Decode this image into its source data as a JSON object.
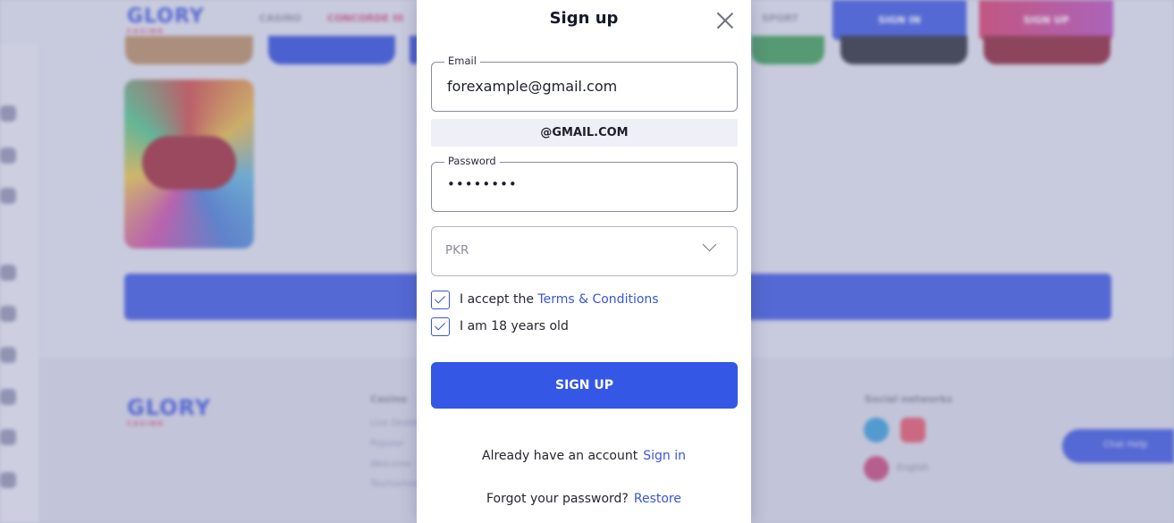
{
  "background": {
    "logo": {
      "word": "GLORY",
      "sub": "CASINO"
    },
    "nav": [
      "CASINO",
      "CONCORDE III",
      "SPORT"
    ],
    "header_buttons": {
      "sign_in": "SIGN IN",
      "sign_up": "SIGN UP"
    },
    "footer": {
      "col_title": "Casino",
      "links": [
        "Live Dealers",
        "Popular",
        "Welcome",
        "Tournaments"
      ],
      "social_title": "Social networks",
      "language": "English",
      "chat": "Chat Help"
    },
    "colors": {
      "brand_blue": "#3b56db",
      "brand_pink": "#d33d6b"
    }
  },
  "modal": {
    "title": "Sign up",
    "email": {
      "label": "Email",
      "value": "forexample@gmail.com"
    },
    "suggestion": "@GMAIL.COM",
    "password": {
      "label": "Password",
      "value": "••••••••"
    },
    "currency": {
      "selected": "PKR"
    },
    "terms": {
      "prefix": "I accept the ",
      "link": "Terms & Conditions",
      "checked": true
    },
    "age": {
      "label": "I am 18 years old",
      "checked": true
    },
    "submit": "SIGN UP",
    "have_account": {
      "text": "Already have an account",
      "link": "Sign in"
    },
    "forgot": {
      "text": "Forgot your password?",
      "link": "Restore"
    },
    "accent": "#3457e6"
  }
}
